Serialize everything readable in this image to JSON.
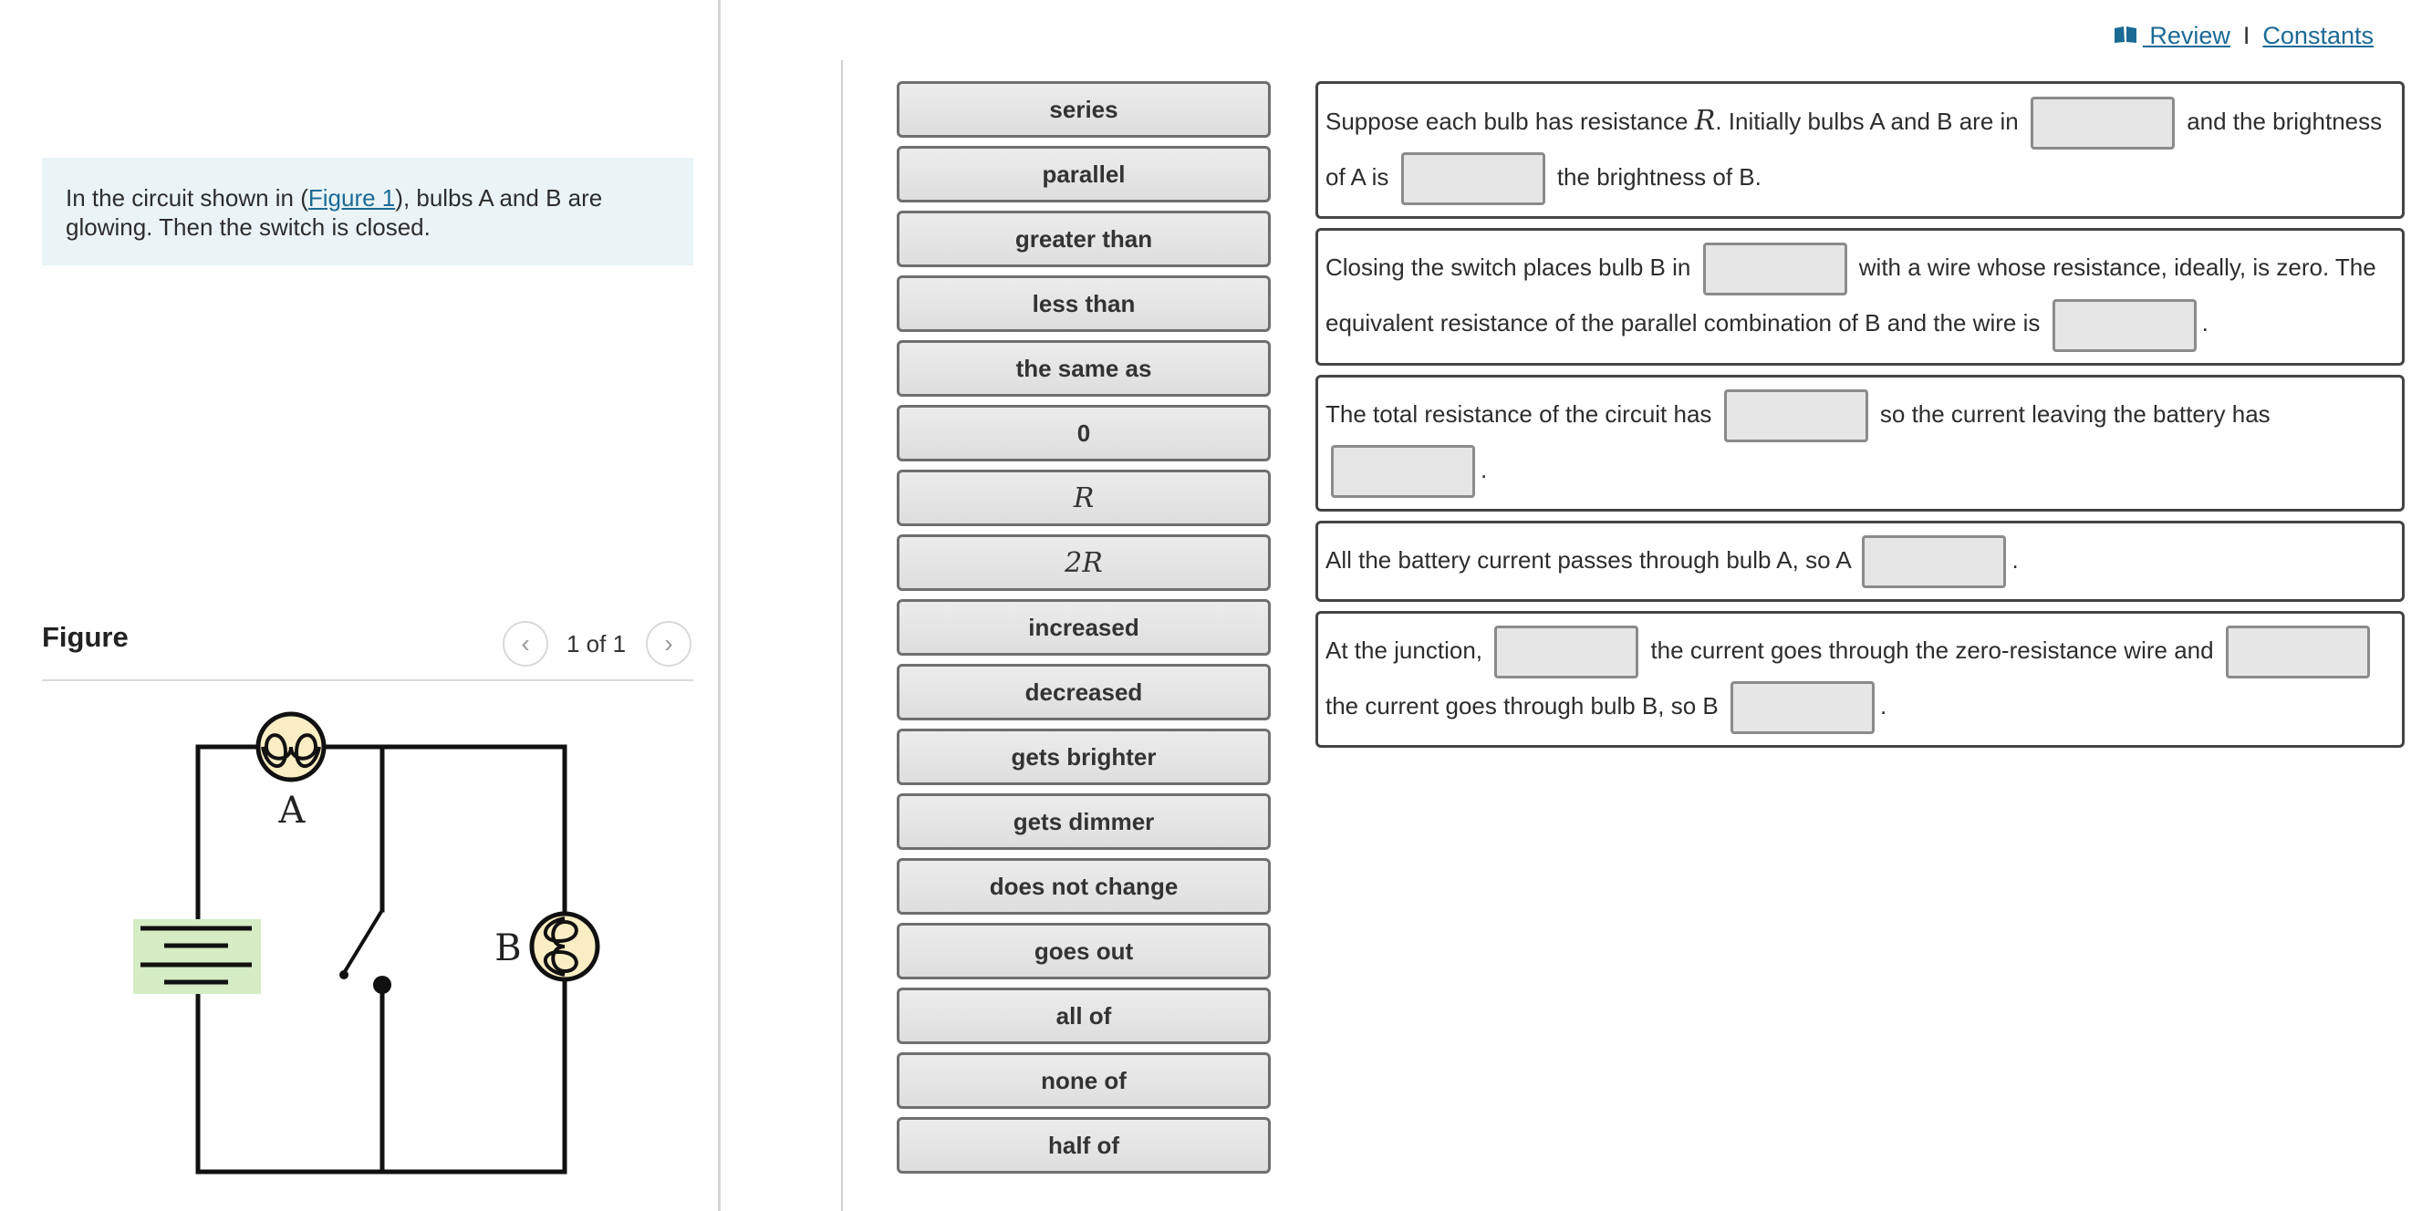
{
  "intro": {
    "before": "In the circuit shown in (",
    "link": "Figure 1",
    "after": "), bulbs A and B are glowing. Then the switch is closed."
  },
  "figure": {
    "title": "Figure",
    "page_count": "1 of 1",
    "labels": {
      "bulb_a": "A",
      "bulb_b": "B"
    }
  },
  "top_links": {
    "review": " Review",
    "separator": "I",
    "constants": "Constants"
  },
  "word_bank": [
    "series",
    "parallel",
    "greater than",
    "less than",
    "the same as",
    "0",
    "R",
    "2R",
    "increased",
    "decreased",
    "gets brighter",
    "gets dimmer",
    "does not change",
    "goes out",
    "all of",
    "none of",
    "half of"
  ],
  "sentences": {
    "s1": {
      "a": "Suppose each bulb has resistance ",
      "var": "R",
      "b": ". Initially bulbs A and B are in ",
      "c": " and the brightness of A is ",
      "d": " the brightness of B."
    },
    "s2": {
      "a": "Closing the switch places bulb B in ",
      "b": " with a wire whose resistance, ideally, is zero. The equivalent resistance of the parallel combination of B and the wire is ",
      "c": "."
    },
    "s3": {
      "a": "The total resistance of the circuit has ",
      "b": " so the current leaving the battery has ",
      "c": "."
    },
    "s4": {
      "a": "All the battery current passes through bulb A, so A ",
      "b": "."
    },
    "s5": {
      "a": "At the junction, ",
      "b": " the current goes through the zero-resistance wire and ",
      "c": " the current goes through bulb B, so B ",
      "d": "."
    }
  },
  "colors": {
    "link": "#1b6a96",
    "intro_bg": "#eaf4f6",
    "battery_bg": "#d5ecc4",
    "bulb_fill": "#fbeec4"
  }
}
